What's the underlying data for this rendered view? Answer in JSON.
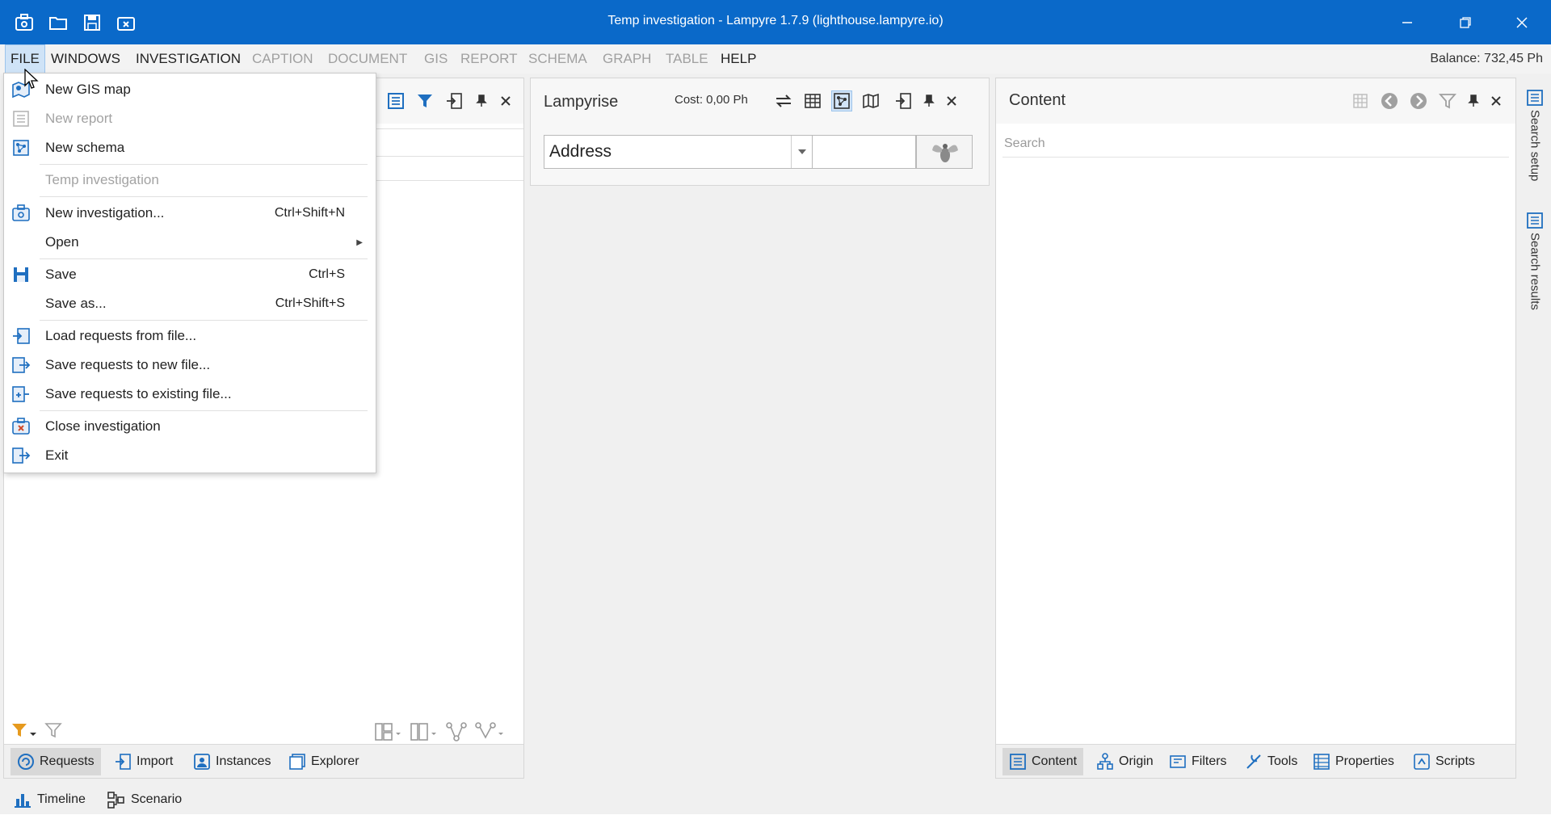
{
  "window": {
    "title": "Temp investigation - Lampyre 1.7.9 (lighthouse.lampyre.io)"
  },
  "menubar": {
    "items": [
      {
        "label": "FILE"
      },
      {
        "label": "WINDOWS"
      },
      {
        "label": "INVESTIGATION"
      },
      {
        "label": "CAPTION"
      },
      {
        "label": "DOCUMENT"
      },
      {
        "label": "GIS"
      },
      {
        "label": "REPORT"
      },
      {
        "label": "SCHEMA"
      },
      {
        "label": "GRAPH"
      },
      {
        "label": "TABLE"
      },
      {
        "label": "HELP"
      }
    ],
    "balance": "Balance: 732,45 Ph"
  },
  "file_menu": {
    "items": [
      {
        "label": "New GIS map",
        "icon": "gis-map-icon"
      },
      {
        "label": "New report",
        "icon": "report-icon"
      },
      {
        "label": "New schema",
        "icon": "schema-icon"
      },
      {
        "label": "Temp investigation"
      },
      {
        "label": "New investigation...",
        "shortcut": "Ctrl+Shift+N",
        "icon": "new-investigation-icon"
      },
      {
        "label": "Open",
        "icon": "submenu-arrow-icon"
      },
      {
        "label": "Save",
        "shortcut": "Ctrl+S",
        "icon": "save-icon"
      },
      {
        "label": "Save as...",
        "shortcut": "Ctrl+Shift+S"
      },
      {
        "label": "Load requests from file...",
        "icon": "load-requests-icon"
      },
      {
        "label": "Save requests to new file...",
        "icon": "save-requests-icon"
      },
      {
        "label": "Save requests to existing file...",
        "icon": "save-requests-existing-icon"
      },
      {
        "label": "Close investigation",
        "icon": "close-investigation-icon"
      },
      {
        "label": "Exit",
        "icon": "exit-icon"
      }
    ]
  },
  "lampyrise": {
    "title": "Lampyrise",
    "cost": "Cost: 0,00 Ph",
    "address_value": "Address"
  },
  "content": {
    "title": "Content",
    "search_placeholder": "Search"
  },
  "left_tabs": [
    {
      "label": "Requests"
    },
    {
      "label": "Import"
    },
    {
      "label": "Instances"
    },
    {
      "label": "Explorer"
    }
  ],
  "content_tabs": [
    {
      "label": "Content"
    },
    {
      "label": "Origin"
    },
    {
      "label": "Filters"
    },
    {
      "label": "Tools"
    },
    {
      "label": "Properties"
    },
    {
      "label": "Scripts"
    }
  ],
  "side_tabs": [
    {
      "label": "Search setup"
    },
    {
      "label": "Search results"
    }
  ],
  "status": [
    {
      "label": "Timeline"
    },
    {
      "label": "Scenario"
    }
  ],
  "colors": {
    "titlebar": "#0a69c9",
    "accent": "#1f6fc0"
  }
}
